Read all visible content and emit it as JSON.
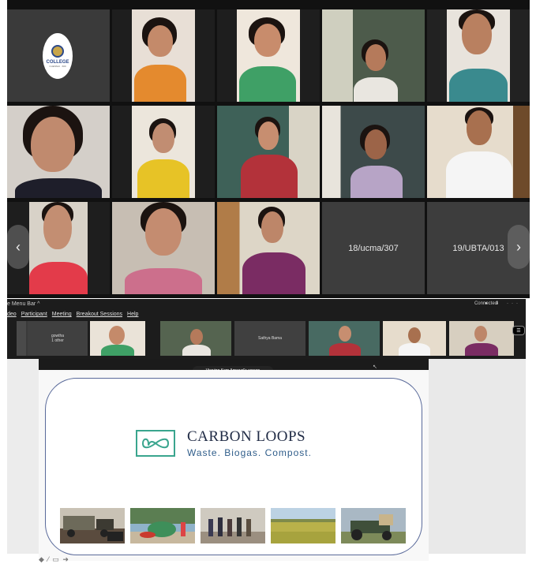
{
  "gallery": {
    "logo_text": "COLLEGE",
    "logo_sub": "CHENNAI · 600",
    "name_tiles": [
      "18/ucma/307",
      "19/UBTA/013"
    ],
    "nav_left": "‹",
    "nav_right": "›"
  },
  "meeting_bar": {
    "title": "e Menu Bar ^",
    "menu": [
      "deo",
      "Participant",
      "Meeting",
      "Breakout Sessions",
      "Help"
    ],
    "status": "Connected",
    "icons": "● ⬇ ···",
    "thumbs": [
      {
        "type": "name",
        "name": "gowtha",
        "sub": "1 other"
      },
      {
        "type": "name",
        "name": "Sathya Bama"
      }
    ],
    "side_button": "☰"
  },
  "shared_screen": {
    "viewing_label": "Viewing Kern Agrawal's screen",
    "slide_title": "CARBON LOOPS",
    "slide_subtitle": "Waste. Biogas. Compost.",
    "footer_icons": "◆ ⁄ ▭ ➜"
  },
  "colors": {
    "accent": "#3aa58e",
    "title": "#1f2a44",
    "subtitle": "#2f5d8a",
    "frame": "#5a6a9a"
  }
}
